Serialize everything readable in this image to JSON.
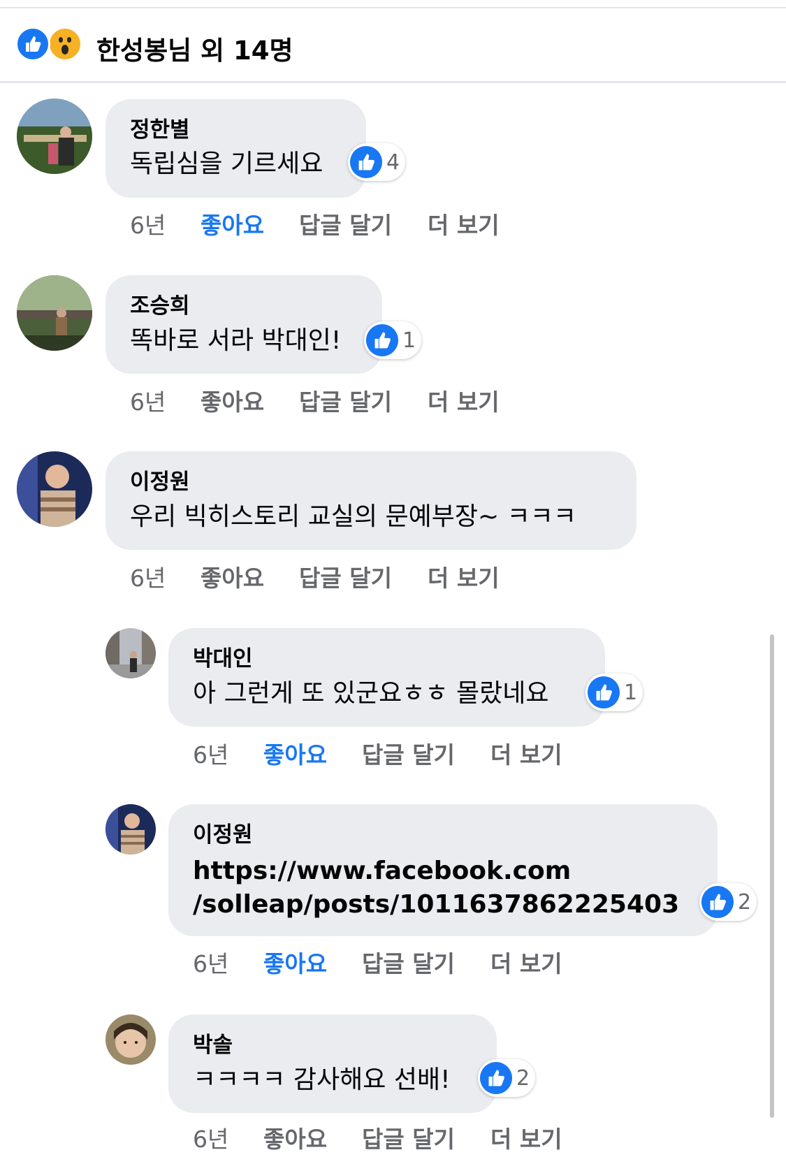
{
  "reactions": {
    "summary": "한성봉님 외 14명",
    "icons": [
      "like-icon",
      "wow-icon"
    ]
  },
  "comments": [
    {
      "name": "정한별",
      "text": "독립심을 기르세요",
      "likes": "4",
      "time": "6년",
      "like": "좋아요",
      "reply": "답글 달기",
      "more": "더 보기"
    },
    {
      "name": "조승희",
      "text": "똑바로 서라 박대인!",
      "likes": "1",
      "time": "6년",
      "like": "좋아요",
      "reply": "답글 달기",
      "more": "더 보기"
    },
    {
      "name": "이정원",
      "text": "우리 빅히스토리 교실의 문예부장~ ㅋㅋㅋ",
      "time": "6년",
      "like": "좋아요",
      "reply": "답글 달기",
      "more": "더 보기"
    },
    {
      "name": "박대인",
      "text": "아 그런게 또 있군요ㅎㅎ 몰랐네요",
      "likes": "1",
      "time": "6년",
      "like": "좋아요",
      "reply": "답글 달기",
      "more": "더 보기"
    },
    {
      "name": "이정원",
      "text_line1": "https://www.facebook.com",
      "text_line2": "/solleap/posts/1011637862225403",
      "likes": "2",
      "time": "6년",
      "like": "좋아요",
      "reply": "답글 달기",
      "more": "더 보기"
    },
    {
      "name": "박솔",
      "text": "ㅋㅋㅋㅋ 감사해요 선배!",
      "likes": "2",
      "time": "6년",
      "like": "좋아요",
      "reply": "답글 달기",
      "more": "더 보기"
    }
  ],
  "colors": {
    "accent": "#1877f2",
    "bubble": "#ebecf0",
    "meta": "#65676b"
  }
}
